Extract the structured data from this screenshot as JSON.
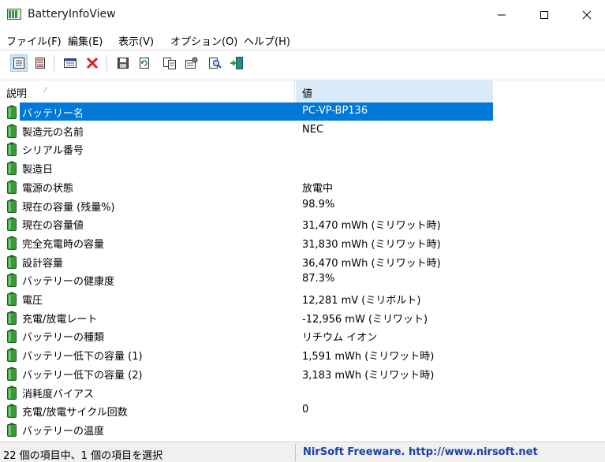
{
  "window": {
    "title": "BatteryInfoView"
  },
  "menu": [
    "ファイル(F)",
    "編集(E)",
    "表示(V)",
    "オプション(O)",
    "ヘルプ(H)"
  ],
  "columns": {
    "description": "説明",
    "value": "値"
  },
  "rows": [
    {
      "name": "バッテリー名",
      "value": "PC-VP-BP136",
      "selected": true
    },
    {
      "name": "製造元の名前",
      "value": "NEC"
    },
    {
      "name": "シリアル番号",
      "value": ""
    },
    {
      "name": "製造日",
      "value": ""
    },
    {
      "name": "電源の状態",
      "value": "放電中"
    },
    {
      "name": "現在の容量 (残量%)",
      "value": "98.9%"
    },
    {
      "name": "現在の容量値",
      "value": "31,470 mWh (ミリワット時)"
    },
    {
      "name": "完全充電時の容量",
      "value": "31,830 mWh (ミリワット時)"
    },
    {
      "name": "設計容量",
      "value": "36,470 mWh (ミリワット時)"
    },
    {
      "name": "バッテリーの健康度",
      "value": "87.3%"
    },
    {
      "name": "電圧",
      "value": "12,281 mV (ミリボルト)"
    },
    {
      "name": "充電/放電レート",
      "value": "-12,956 mW (ミリワット)"
    },
    {
      "name": "バッテリーの種類",
      "value": "リチウム イオン"
    },
    {
      "name": "バッテリー低下の容量 (1)",
      "value": "1,591 mWh (ミリワット時)"
    },
    {
      "name": "バッテリー低下の容量 (2)",
      "value": "3,183 mWh (ミリワット時)"
    },
    {
      "name": "消耗度バイアス",
      "value": ""
    },
    {
      "name": "充電/放電サイクル回数",
      "value": "0"
    },
    {
      "name": "バッテリーの温度",
      "value": ""
    }
  ],
  "status": {
    "items": "22 個の項目中、1 個の項目を選択",
    "credit": "NirSoft Freeware.  http://www.nirsoft.net"
  },
  "colors": {
    "selection": "#0078d7",
    "header_highlight": "#d9ebf9",
    "battery_green": "#3a9a3a",
    "link_blue": "#1c3fa8"
  },
  "toolbar_icons": [
    "properties-icon",
    "report-icon",
    "html-report-icon",
    "delete-icon",
    "save-icon",
    "refresh-icon",
    "copy-icon",
    "options-icon",
    "find-icon",
    "exit-icon"
  ]
}
